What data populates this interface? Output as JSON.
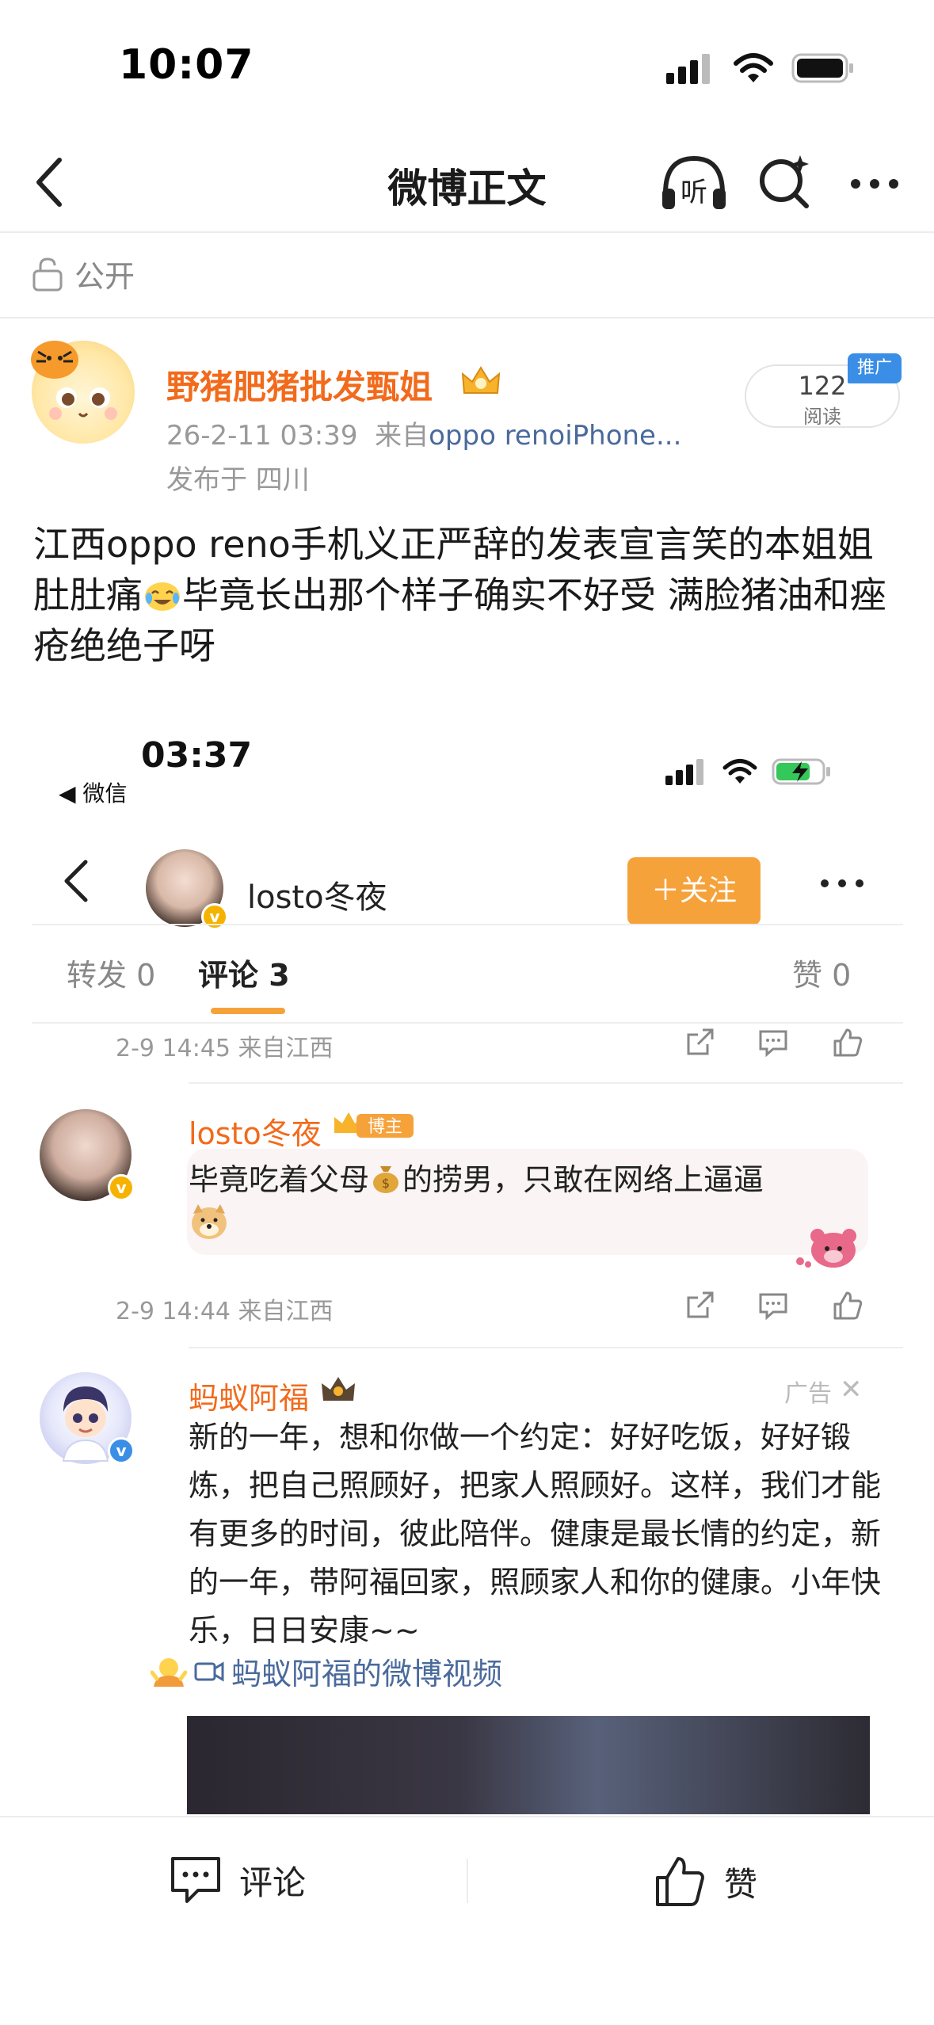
{
  "status_bar": {
    "time": "10:07"
  },
  "nav": {
    "title": "微博正文",
    "listen_label": "听"
  },
  "visibility": {
    "label": "公开"
  },
  "post": {
    "author": "野猪肥猪批发甄姐",
    "date": "26-2-11 03:39",
    "source_prefix": "来自",
    "source": "oppo renoiPhone...",
    "location": "发布于 四川",
    "read_count": "122",
    "read_label": "阅读",
    "promo_tag": "推广",
    "text_part1": "江西oppo reno手机义正严辞的发表宣言笑的本姐姐肚肚痛",
    "text_part2": "毕竟长出那个样子确实不好受 满脸猪油和痤疮绝绝子呀"
  },
  "embedded": {
    "time": "03:37",
    "back_app": "◀ 微信",
    "header": {
      "username": "losto冬夜",
      "follow_label": "＋关注"
    },
    "tabs": [
      {
        "label": "转发 0"
      },
      {
        "label": "评论 3"
      },
      {
        "label": "赞 0"
      }
    ],
    "row1_meta": "2-9 14:45  来自江西",
    "comment": {
      "name": "losto冬夜",
      "badge": "博主",
      "text_part1": "毕竟吃着父母",
      "text_part2": "的捞男，只敢在网络上逼逼",
      "meta": "2-9 14:44  来自江西"
    },
    "ad": {
      "name": "蚂蚁阿福",
      "tag": "广告",
      "close": "✕",
      "text": "新的一年，想和你做一个约定：好好吃饭，好好锻炼，把自己照顾好，把家人照顾好。这样，我们才能有更多的时间，彼此陪伴。健康是最长情的约定，新的一年，带阿福回家，照顾家人和你的健康。小年快乐，日日安康~~",
      "video_link": "蚂蚁阿福的微博视频"
    }
  },
  "bottom_bar": {
    "comment_label": "评论",
    "like_label": "赞"
  },
  "colors": {
    "accent_orange": "#f26a1b",
    "follow_orange": "#f6a23b",
    "link_blue": "#4a6a9c",
    "promo_blue": "#3a8ee6"
  }
}
